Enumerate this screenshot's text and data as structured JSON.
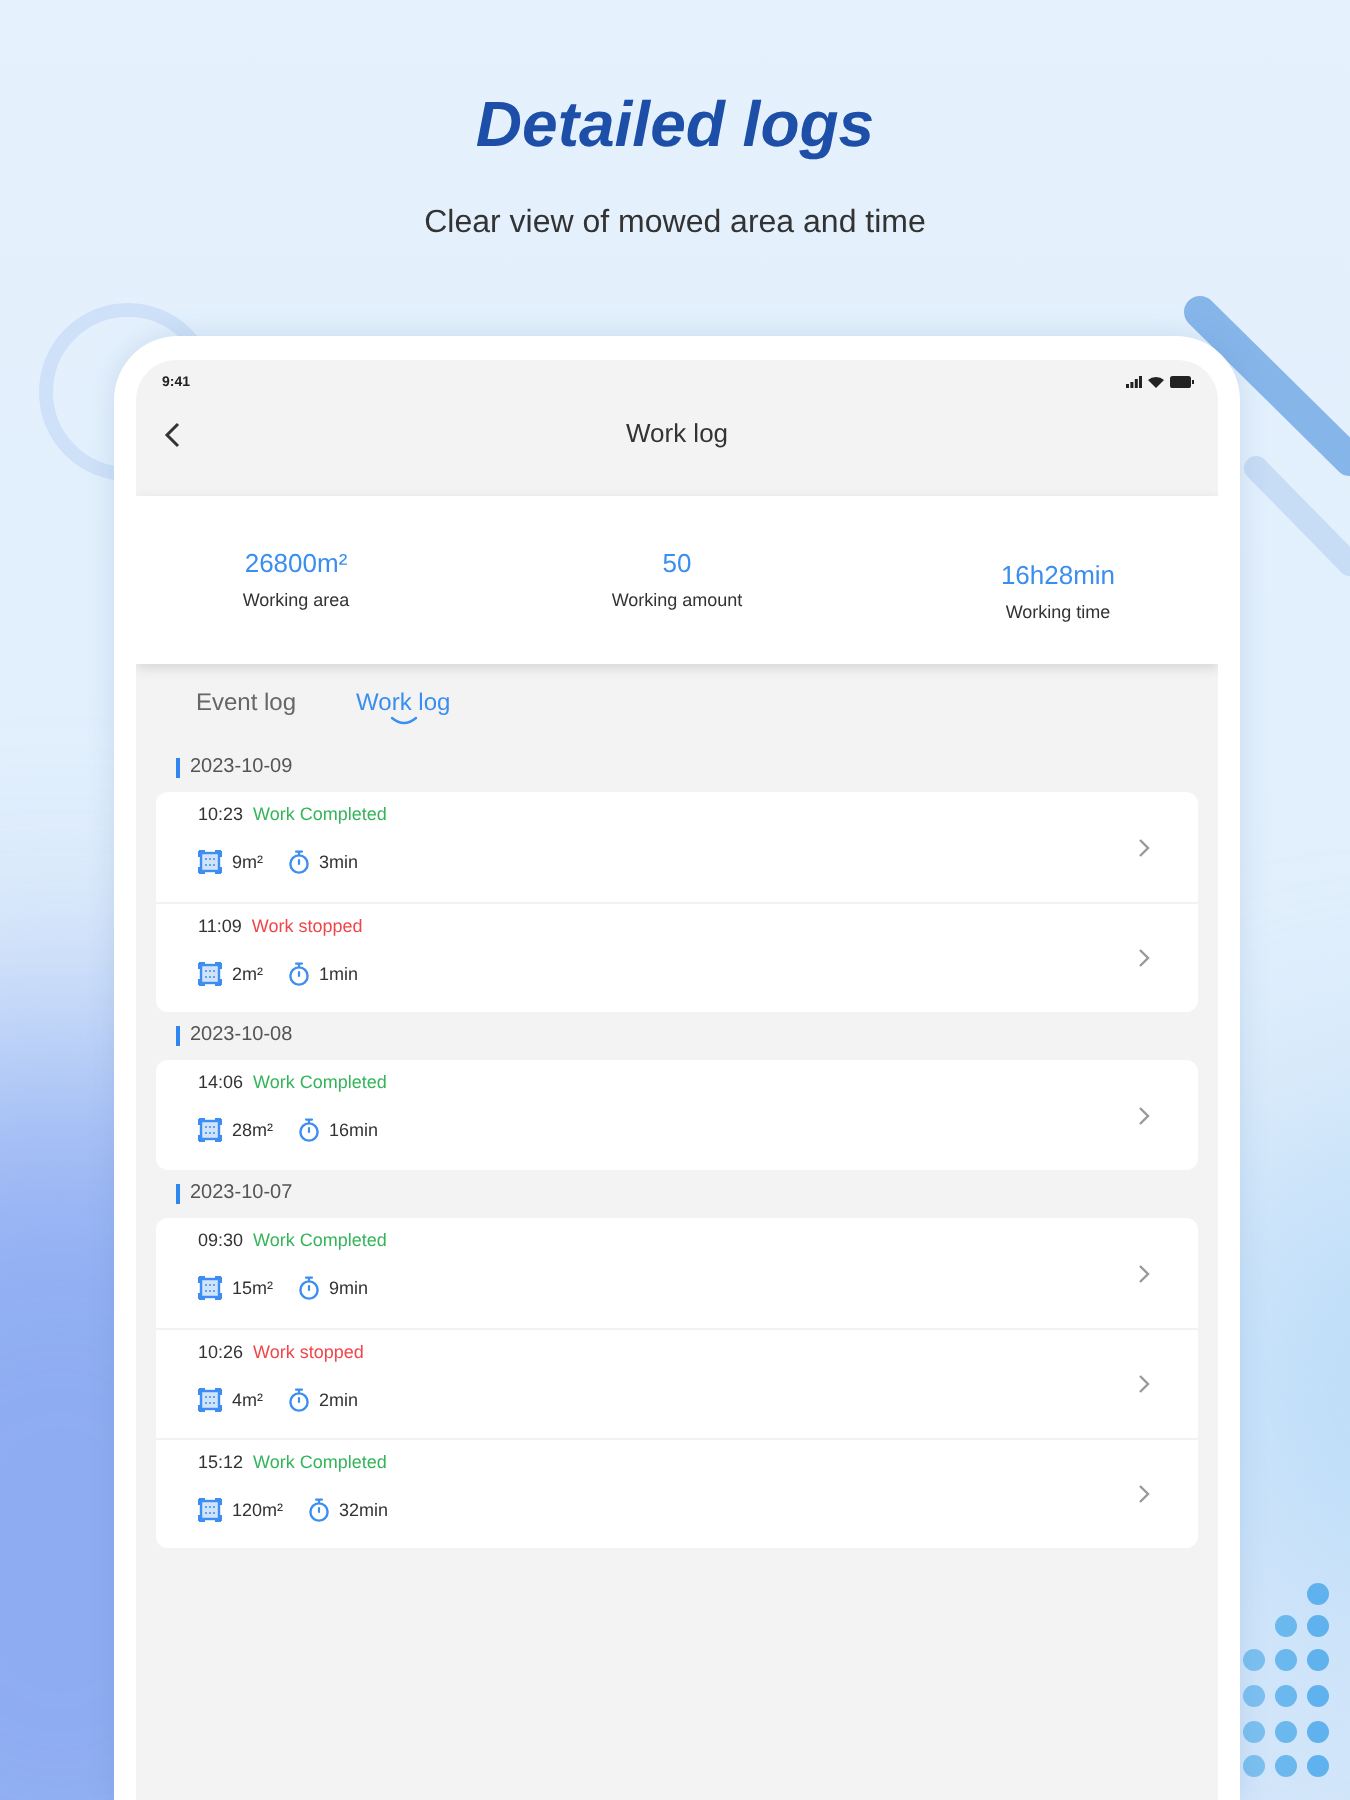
{
  "header": {
    "title": "Detailed logs",
    "subtitle": "Clear view of mowed area and time"
  },
  "status_bar": {
    "time": "9:41"
  },
  "nav": {
    "title": "Work log"
  },
  "summary": [
    {
      "value": "26800m²",
      "label": "Working area"
    },
    {
      "value": "50",
      "label": "Working amount"
    },
    {
      "value": "16h28min",
      "label": "Working time"
    }
  ],
  "tabs": [
    {
      "label": "Event log",
      "selected": false
    },
    {
      "label": "Work log",
      "selected": true
    }
  ],
  "days": [
    {
      "date": "2023-10-09",
      "entries": [
        {
          "time": "10:23",
          "status": "Work Completed",
          "color": "#34b55a",
          "area": "9m²",
          "duration": "3min"
        },
        {
          "time": "11:09",
          "status": "Work stopped",
          "color": "#f0464a",
          "area": "2m²",
          "duration": "1min"
        }
      ]
    },
    {
      "date": "2023-10-08",
      "entries": [
        {
          "time": "14:06",
          "status": "Work Completed",
          "color": "#34b55a",
          "area": "28m²",
          "duration": "16min"
        }
      ]
    },
    {
      "date": "2023-10-07",
      "entries": [
        {
          "time": "09:30",
          "status": "Work Completed",
          "color": "#34b55a",
          "area": "15m²",
          "duration": "9min"
        },
        {
          "time": "10:26",
          "status": "Work stopped",
          "color": "#f0464a",
          "area": "4m²",
          "duration": "2min"
        },
        {
          "time": "15:12",
          "status": "Work Completed",
          "color": "#34b55a",
          "area": "120m²",
          "duration": "32min"
        }
      ]
    }
  ]
}
